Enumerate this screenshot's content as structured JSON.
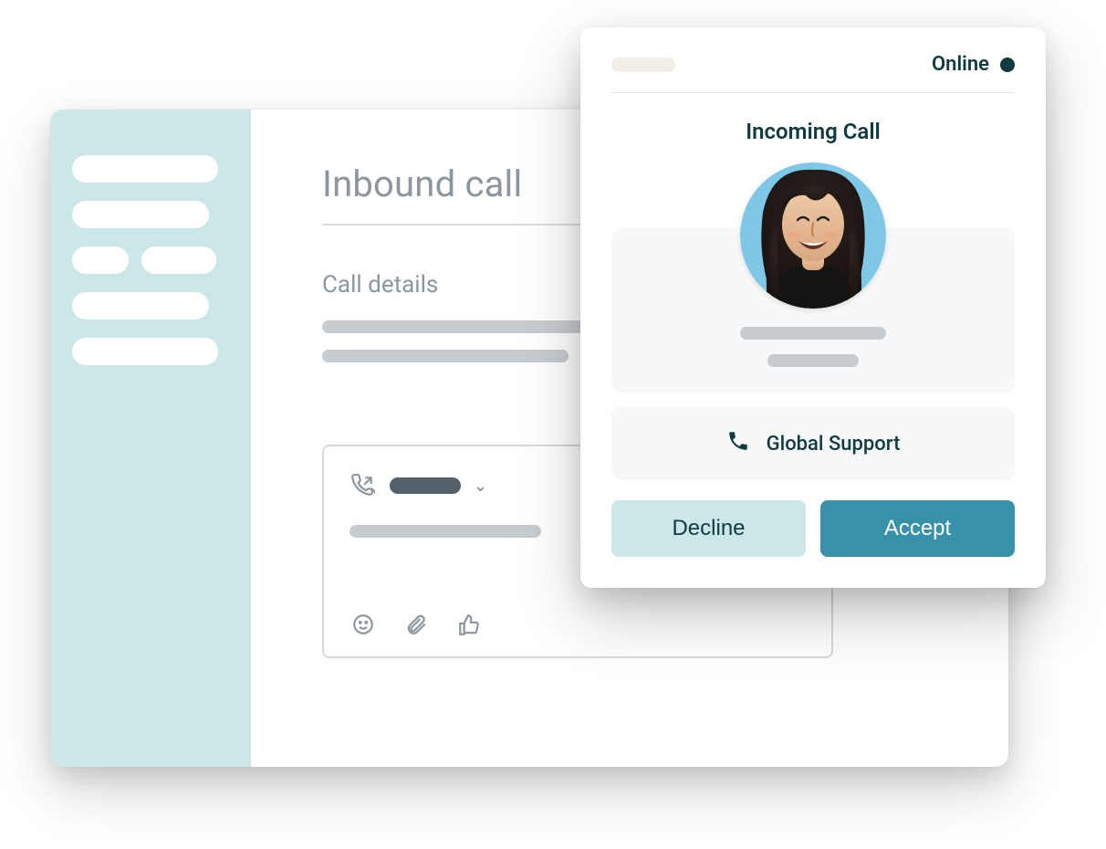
{
  "colors": {
    "sidebar_bg": "#cbe7e8",
    "text_dark_teal": "#0f3b3f",
    "accent_teal": "#3791a8",
    "muted_gray": "#8b969e"
  },
  "main": {
    "title": "Inbound call",
    "section_label": "Call details"
  },
  "call_panel": {
    "status_text": "Online",
    "title": "Incoming Call",
    "support_label": "Global Support",
    "decline_label": "Decline",
    "accept_label": "Accept"
  }
}
